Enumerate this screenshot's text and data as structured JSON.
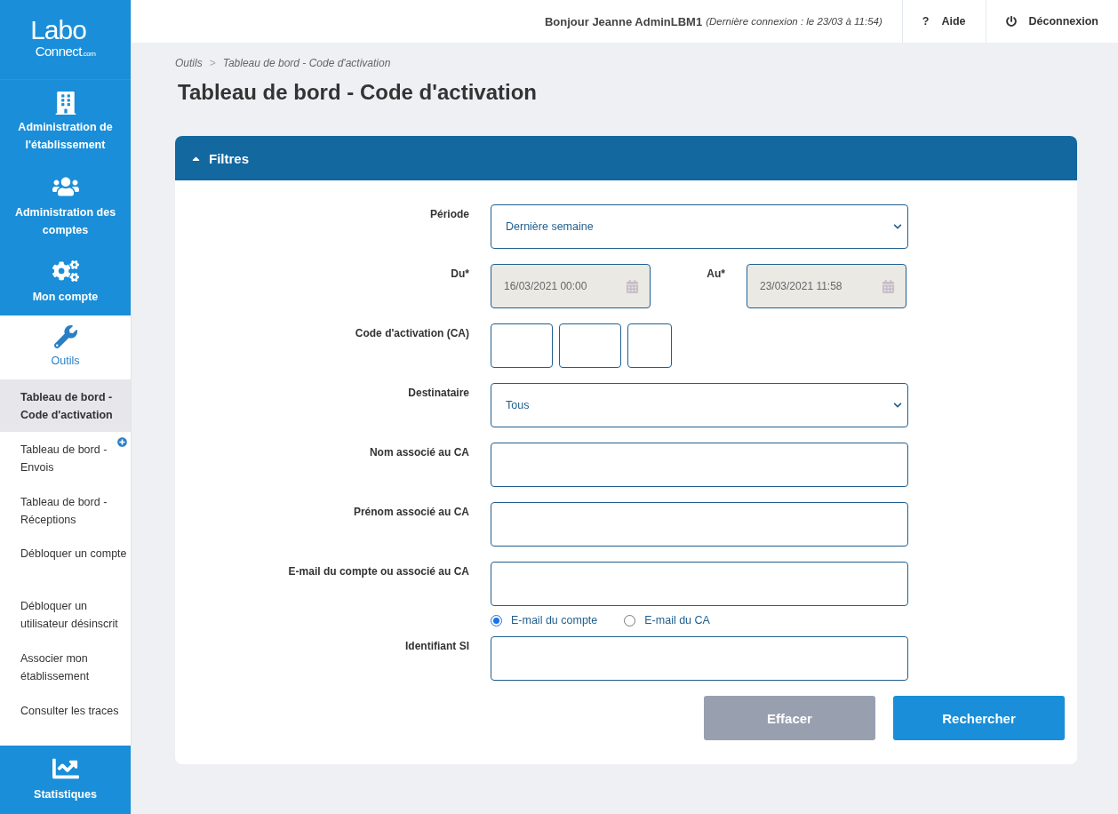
{
  "logo": {
    "line1": "Labo",
    "line2": "Connect",
    "suffix": ".com"
  },
  "nav": [
    {
      "kind": "building",
      "label": "Administration de l'établissement",
      "selected": false
    },
    {
      "kind": "users",
      "label": "Administration des comptes",
      "selected": false
    },
    {
      "kind": "gears",
      "label": "Mon compte",
      "selected": false
    },
    {
      "kind": "wrench",
      "label": "Outils",
      "selected": true,
      "children": [
        {
          "label": "Tableau de bord - Code d'activation",
          "selected": true,
          "expandable": false
        },
        {
          "label": "Tableau de bord - Envois",
          "selected": false,
          "expandable": true
        },
        {
          "label": "Tableau de bord - Réceptions",
          "selected": false,
          "expandable": false
        },
        {
          "label": "Débloquer un compte",
          "selected": false,
          "expandable": false
        },
        {
          "label": "Débloquer un utilisateur désinscrit",
          "selected": false,
          "expandable": false
        },
        {
          "label": "Associer mon établissement",
          "selected": false,
          "expandable": false
        },
        {
          "label": "Consulter les traces",
          "selected": false,
          "expandable": false
        }
      ]
    },
    {
      "kind": "chart",
      "label": "Statistiques",
      "selected": false
    }
  ],
  "header": {
    "greeting": "Bonjour Jeanne AdminLBM1",
    "last_login": "(Dernière connexion : le 23/03 à 11:54)",
    "actions": [
      {
        "kind": "help",
        "icon": "?",
        "label": "Aide"
      },
      {
        "kind": "logout",
        "label": "Déconnexion"
      }
    ]
  },
  "breadcrumb": {
    "separator": ">",
    "items": [
      "Outils",
      "Tableau de bord - Code d'activation"
    ]
  },
  "title": "Tableau de bord - Code d'activation",
  "filters": {
    "title": "Filtres",
    "expanded": true,
    "rows": [
      {
        "kind": "select",
        "label": "Période",
        "value": "Dernière semaine"
      },
      {
        "kind": "dates",
        "label": "Du*",
        "value": "16/03/2021 00:00",
        "label2": "Au*",
        "value2": "23/03/2021 11:58"
      },
      {
        "kind": "code",
        "label": "Code d'activation (CA)"
      },
      {
        "kind": "select",
        "label": "Destinataire",
        "value": "Tous"
      },
      {
        "kind": "text",
        "label": "Nom associé au CA"
      },
      {
        "kind": "text",
        "label": "Prénom associé au CA"
      },
      {
        "kind": "text",
        "label": "E-mail du compte ou associé au CA"
      },
      {
        "kind": "radio",
        "options": [
          {
            "label": "E-mail du compte",
            "selected": true
          },
          {
            "label": "E-mail du CA",
            "selected": false
          }
        ]
      },
      {
        "kind": "text",
        "label": "Identifiant SI"
      }
    ],
    "buttons": [
      {
        "kind": "secondary",
        "label": "Effacer"
      },
      {
        "kind": "primary",
        "label": "Rechercher"
      }
    ]
  }
}
